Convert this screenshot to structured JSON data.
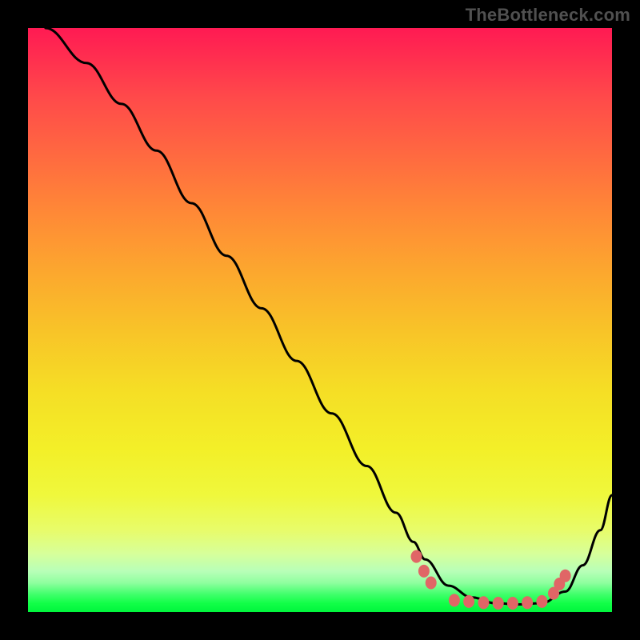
{
  "watermark": "TheBottleneck.com",
  "chart_data": {
    "type": "line",
    "title": "",
    "xlabel": "",
    "ylabel": "",
    "xlim": [
      0,
      100
    ],
    "ylim": [
      0,
      100
    ],
    "grid": false,
    "legend": false,
    "series": [
      {
        "name": "curve",
        "color": "#000000",
        "x": [
          3,
          10,
          16,
          22,
          28,
          34,
          40,
          46,
          52,
          58,
          63,
          66,
          68,
          72,
          76,
          80,
          84,
          88,
          92,
          95,
          98,
          100
        ],
        "y": [
          100,
          94,
          87,
          79,
          70,
          61,
          52,
          43,
          34,
          25,
          17,
          12,
          9,
          4.5,
          2.5,
          1.5,
          1.3,
          1.5,
          3.5,
          8,
          14,
          20
        ]
      }
    ],
    "markers": {
      "name": "sweet-spot",
      "color": "#e06666",
      "points": [
        {
          "x": 66.5,
          "y": 9.5
        },
        {
          "x": 67.8,
          "y": 7.0
        },
        {
          "x": 69.0,
          "y": 5.0
        },
        {
          "x": 73.0,
          "y": 2.0
        },
        {
          "x": 75.5,
          "y": 1.8
        },
        {
          "x": 78.0,
          "y": 1.6
        },
        {
          "x": 80.5,
          "y": 1.5
        },
        {
          "x": 83.0,
          "y": 1.5
        },
        {
          "x": 85.5,
          "y": 1.6
        },
        {
          "x": 88.0,
          "y": 1.8
        },
        {
          "x": 90.0,
          "y": 3.2
        },
        {
          "x": 91.0,
          "y": 4.8
        },
        {
          "x": 92.0,
          "y": 6.2
        }
      ]
    },
    "gradient_note": "background encodes bottleneck severity: red high, green low"
  }
}
